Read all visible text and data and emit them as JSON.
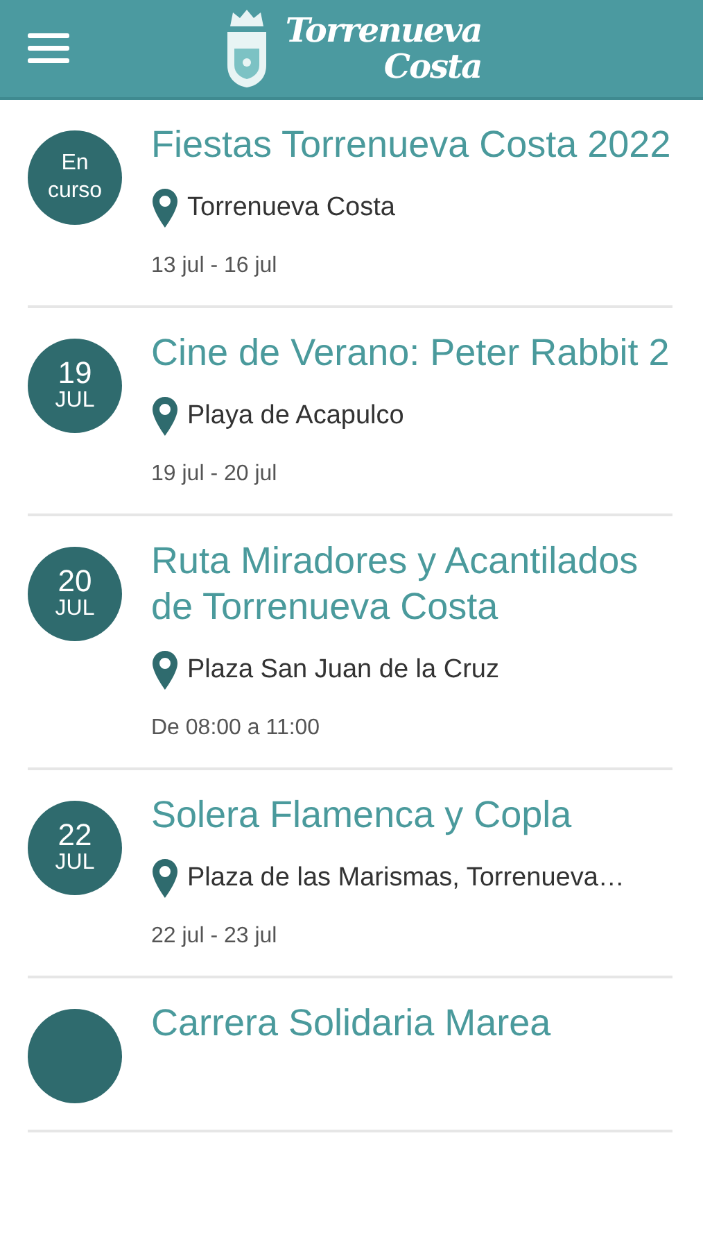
{
  "header": {
    "logo_text": [
      "Torrenueva",
      "Costa"
    ]
  },
  "events": [
    {
      "badge": {
        "kind": "status",
        "text": "En curso"
      },
      "title": "Fiestas Torrenueva Costa 2022",
      "location": "Torrenueva Costa",
      "when": "13 jul - 16 jul"
    },
    {
      "badge": {
        "kind": "date",
        "day": "19",
        "month": "JUL"
      },
      "title": "Cine de Verano: Peter Rabbit 2",
      "location": "Playa de Acapulco",
      "when": "19 jul - 20 jul"
    },
    {
      "badge": {
        "kind": "date",
        "day": "20",
        "month": "JUL"
      },
      "title": "Ruta Miradores y Acantilados de Torrenueva Costa",
      "location": "Plaza San Juan de la Cruz",
      "when": "De 08:00 a 11:00"
    },
    {
      "badge": {
        "kind": "date",
        "day": "22",
        "month": "JUL"
      },
      "title": "Solera Flamenca y Copla",
      "location": "Plaza de las Marismas, Torrenueva…",
      "when": "22 jul - 23 jul"
    },
    {
      "badge": {
        "kind": "blank"
      },
      "title": "Carrera Solidaria Marea"
    }
  ]
}
